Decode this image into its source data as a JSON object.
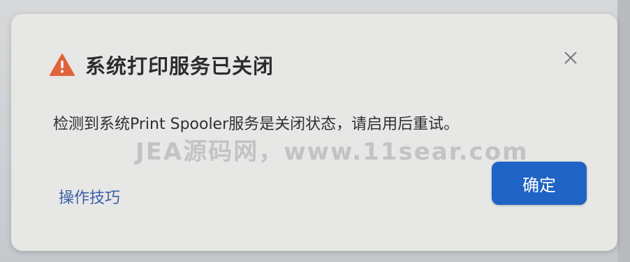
{
  "dialog": {
    "title": "系统打印服务已关闭",
    "message": "检测到系统Print Spooler服务是关闭状态，请启用后重试。",
    "tips_link": "操作技巧",
    "ok_label": "确定",
    "close_icon": "close-icon",
    "warning_icon": "warning-triangle-icon"
  },
  "watermark": "JEA源码网，www.11sear.com",
  "colors": {
    "warning": "#e0633a",
    "primary": "#1f63c4",
    "link": "#3c5fa8"
  }
}
